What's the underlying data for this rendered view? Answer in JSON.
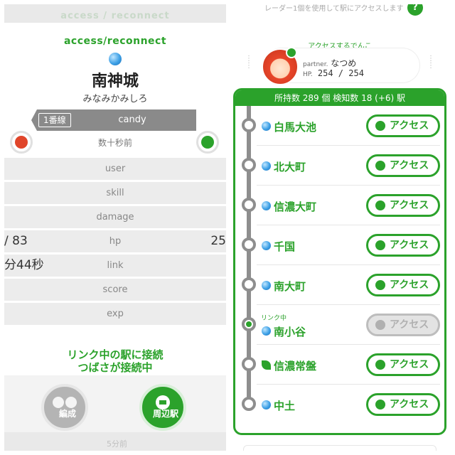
{
  "left": {
    "ghost_top": "access / reconnect",
    "access_title": "access/reconnect",
    "station_name": "南神城",
    "station_kana": "みなみかみしろ",
    "line_label": "1番線",
    "line_name": "candy",
    "time_ago": "数十秒前",
    "stats": [
      {
        "label": "user",
        "left": "",
        "right": ""
      },
      {
        "label": "skill",
        "left": "",
        "right": ""
      },
      {
        "label": "damage",
        "left": "",
        "right": ""
      },
      {
        "label": "hp",
        "left": "/ 83",
        "right": "25"
      },
      {
        "label": "link",
        "left": "分44秒",
        "right": ""
      },
      {
        "label": "score",
        "left": "",
        "right": ""
      },
      {
        "label": "exp",
        "left": "",
        "right": ""
      }
    ],
    "connect_line1": "リンク中の駅に接続",
    "connect_line2": "つばさが接続中",
    "buttons": {
      "formation": "編成",
      "nearby": "周辺駅"
    },
    "ghost_bottom": "5分前",
    "colors": {
      "green": "#2ba22b",
      "fire": "#e0452a",
      "grass": "#2ba22b"
    },
    "icons": {
      "fire": "fire-attribute-icon",
      "grass": "grass-attribute-icon",
      "water": "water-attribute-icon"
    }
  },
  "right": {
    "radar_note": "レーダー1個を使用して駅にアクセスします",
    "help_label": "?",
    "partner_title": "アクセスするでんこ",
    "partner_prefix": "partner.",
    "partner_name": "なつめ",
    "hp_prefix": "HP.",
    "hp_value": "254 / 254",
    "list_header": "所持数 289 個 検知数 18 (+6) 駅",
    "access_label": "アクセス",
    "link_label": "リンク中",
    "stations": [
      {
        "name": "白馬大池",
        "attr": "water",
        "linked": false,
        "enabled": true
      },
      {
        "name": "北大町",
        "attr": "water",
        "linked": false,
        "enabled": true
      },
      {
        "name": "信濃大町",
        "attr": "water",
        "linked": false,
        "enabled": true
      },
      {
        "name": "千国",
        "attr": "water",
        "linked": false,
        "enabled": true
      },
      {
        "name": "南大町",
        "attr": "water",
        "linked": false,
        "enabled": true
      },
      {
        "name": "南小谷",
        "attr": "water",
        "linked": true,
        "enabled": false
      },
      {
        "name": "信濃常盤",
        "attr": "grass",
        "linked": false,
        "enabled": true
      },
      {
        "name": "中土",
        "attr": "water",
        "linked": false,
        "enabled": true
      }
    ]
  }
}
